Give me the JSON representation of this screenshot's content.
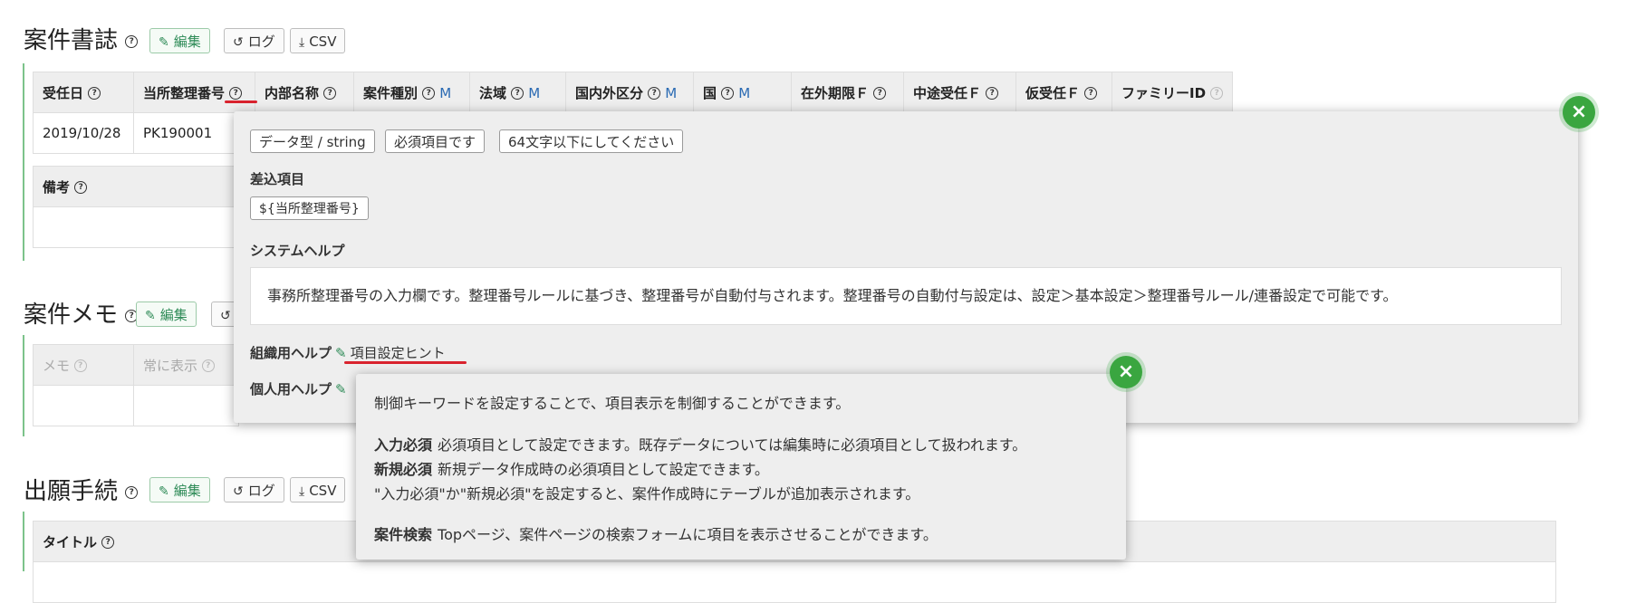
{
  "section1": {
    "title": "案件書誌",
    "buttons": {
      "edit": "編集",
      "log": "ログ",
      "csv": "CSV"
    },
    "table_headers": [
      {
        "label": "受任日",
        "m": ""
      },
      {
        "label": "当所整理番号",
        "m": ""
      },
      {
        "label": "内部名称",
        "m": ""
      },
      {
        "label": "案件種別",
        "m": "M"
      },
      {
        "label": "法域",
        "m": "M"
      },
      {
        "label": "国内外区分",
        "m": "M"
      },
      {
        "label": "国",
        "m": "M"
      },
      {
        "label": "在外期限Ｆ",
        "m": ""
      },
      {
        "label": "中途受任Ｆ",
        "m": ""
      },
      {
        "label": "仮受任Ｆ",
        "m": ""
      },
      {
        "label": "ファミリーID",
        "m": ""
      }
    ],
    "row": {
      "date": "2019/10/28",
      "number": "PK190001"
    },
    "remarks_header": "備考"
  },
  "section2": {
    "title": "案件メモ",
    "buttons": {
      "edit": "編集"
    },
    "headers": {
      "memo": "メモ",
      "always": "常に表示"
    }
  },
  "section3": {
    "title": "出願手続",
    "buttons": {
      "edit": "編集",
      "log": "ログ",
      "csv": "CSV"
    },
    "header": "タイトル"
  },
  "popup1": {
    "chips": [
      "データ型 / string",
      "必須項目です",
      "64文字以下にしてください"
    ],
    "insert_label": "差込項目",
    "insert_value": "${当所整理番号}",
    "system_help_label": "システムヘルプ",
    "system_help_text": "事務所整理番号の入力欄です。整理番号ルールに基づき、整理番号が自動付与されます。整理番号の自動付与設定は、設定＞基本設定＞整理番号ルール/連番設定で可能です。",
    "org_help_label": "組織用ヘルプ",
    "org_help_link": "項目設定ヒント",
    "personal_help_label": "個人用ヘルプ",
    "close": "×"
  },
  "popup2": {
    "intro": "制御キーワードを設定することで、項目表示を制御することができます。",
    "lines": [
      {
        "key": "入力必須",
        "text": "必須項目として設定できます。既存データについては編集時に必須項目として扱われます。"
      },
      {
        "key": "新規必須",
        "text": "新規データ作成時の必須項目として設定できます。"
      },
      {
        "key": "",
        "text": "\"入力必須\"か\"新規必須\"を設定すると、案件作成時にテーブルが追加表示されます。"
      },
      {
        "key": "案件検索",
        "text": "Topページ、案件ページの検索フォームに項目を表示させることができます。"
      }
    ],
    "close": "×"
  },
  "icons": {
    "help": "question-circle-icon",
    "edit": "edit-icon",
    "log": "history-icon",
    "csv": "download-icon",
    "close": "close-icon"
  },
  "colors": {
    "accent_green": "#3aa640",
    "link_blue": "#2a6ab3",
    "annotation_red": "#d9232e"
  }
}
